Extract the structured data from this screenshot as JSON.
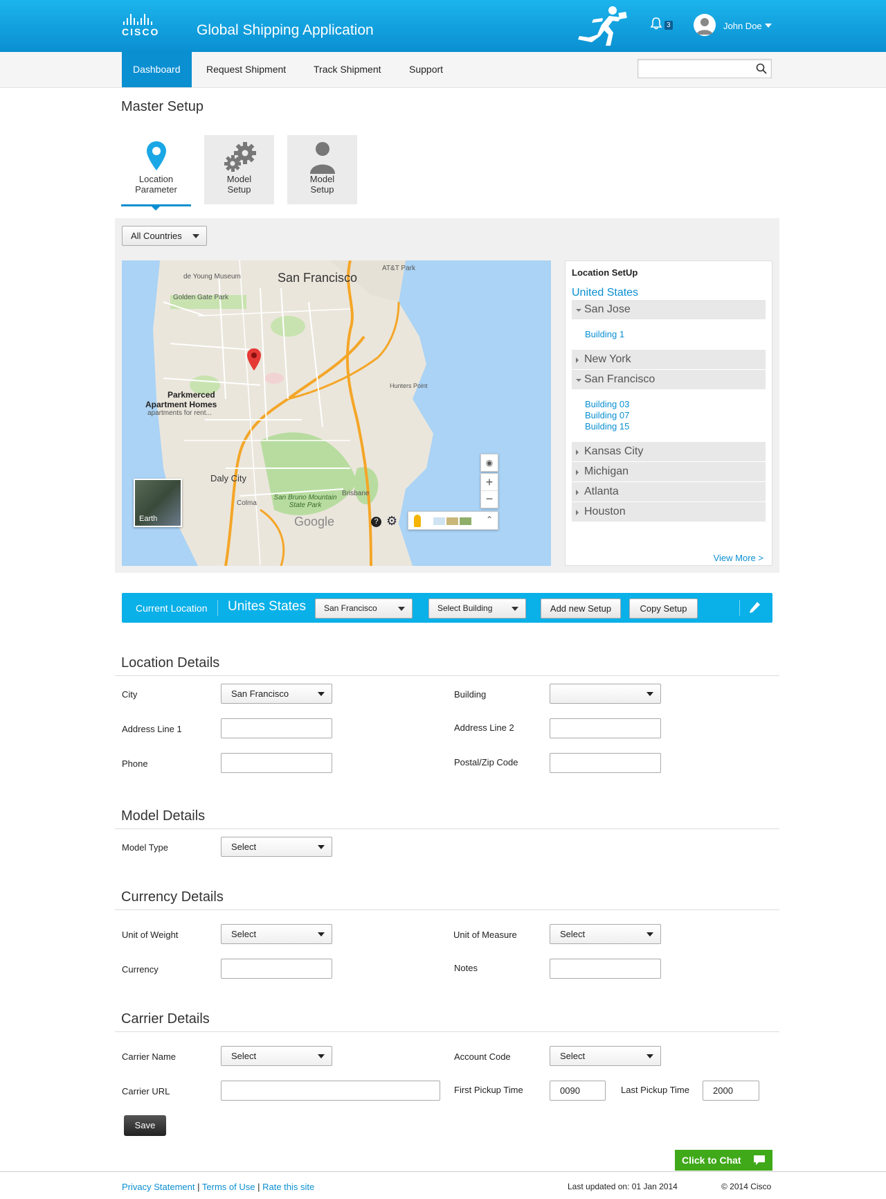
{
  "header": {
    "logo_text": "CISCO",
    "app_title": "Global Shipping Application",
    "notification_count": "3",
    "user_name": "John Doe"
  },
  "nav": {
    "items": [
      {
        "label": "Dashboard",
        "active": true
      },
      {
        "label": "Request Shipment"
      },
      {
        "label": "Track Shipment"
      },
      {
        "label": "Support"
      }
    ],
    "search_value": ""
  },
  "page_title": "Master Setup",
  "setup_tiles": [
    {
      "line1": "Location",
      "line2": "Parameter",
      "icon": "location-pin-icon",
      "active": true
    },
    {
      "line1": "Model",
      "line2": "Setup",
      "icon": "gears-icon"
    },
    {
      "line1": "Model",
      "line2": "Setup",
      "icon": "person-icon"
    }
  ],
  "country_filter": "All Countries",
  "map": {
    "labels": [
      "San Francisco",
      "AT&T Park",
      "Golden Gate Park",
      "de Young Museum",
      "Parkmerced",
      "Apartment Homes",
      "apartments for rent...",
      "Daly City",
      "Colma",
      "Brisbane",
      "San Bruno Mountain State Park",
      "Hunters Point",
      "Earth",
      "Google"
    ]
  },
  "location_setup": {
    "title": "Location SetUp",
    "country": "United States",
    "cities": [
      {
        "name": "San Jose",
        "expanded": true,
        "buildings": [
          "Building 1"
        ]
      },
      {
        "name": "New York",
        "expanded": false
      },
      {
        "name": "San Francisco",
        "expanded": true,
        "buildings": [
          "Building 03",
          "Building 07",
          "Building 15"
        ]
      },
      {
        "name": "Kansas City",
        "expanded": false
      },
      {
        "name": "Michigan",
        "expanded": false
      },
      {
        "name": "Atlanta",
        "expanded": false
      },
      {
        "name": "Houston",
        "expanded": false
      }
    ],
    "view_more": "View More >"
  },
  "current_location": {
    "label": "Current Location",
    "country": "Unites States",
    "city_select": "San Francisco",
    "building_select": "Select Building",
    "add_button": "Add new Setup",
    "copy_button": "Copy Setup"
  },
  "location_details": {
    "title": "Location Details",
    "city_label": "City",
    "city_value": "San Francisco",
    "building_label": "Building",
    "building_value": "",
    "address1_label": "Address Line 1",
    "address2_label": "Address Line 2",
    "phone_label": "Phone",
    "zip_label": "Postal/Zip Code"
  },
  "model_details": {
    "title": "Model Details",
    "model_type_label": "Model Type",
    "model_type_value": "Select"
  },
  "currency_details": {
    "title": "Currency Details",
    "weight_label": "Unit of Weight",
    "weight_value": "Select",
    "measure_label": "Unit of Measure",
    "measure_value": "Select",
    "currency_label": "Currency",
    "notes_label": "Notes"
  },
  "carrier_details": {
    "title": "Carrier Details",
    "name_label": "Carrier Name",
    "name_value": "Select",
    "account_label": "Account Code",
    "account_value": "Select",
    "url_label": "Carrier URL",
    "first_pickup_label": "First Pickup Time",
    "first_pickup_value": "0090",
    "last_pickup_label": "Last Pickup Time",
    "last_pickup_value": "2000"
  },
  "save_label": "Save",
  "chat_label": "Click to Chat",
  "footer": {
    "privacy": "Privacy Statement",
    "terms": "Terms of Use",
    "rate": "Rate this site",
    "updated": "Last updated on: 01 Jan 2014",
    "copyright": "© 2014 Cisco"
  },
  "colors": {
    "primary": "#0a8fd1",
    "bar": "#0ab0e8",
    "chat": "#3fa919"
  }
}
